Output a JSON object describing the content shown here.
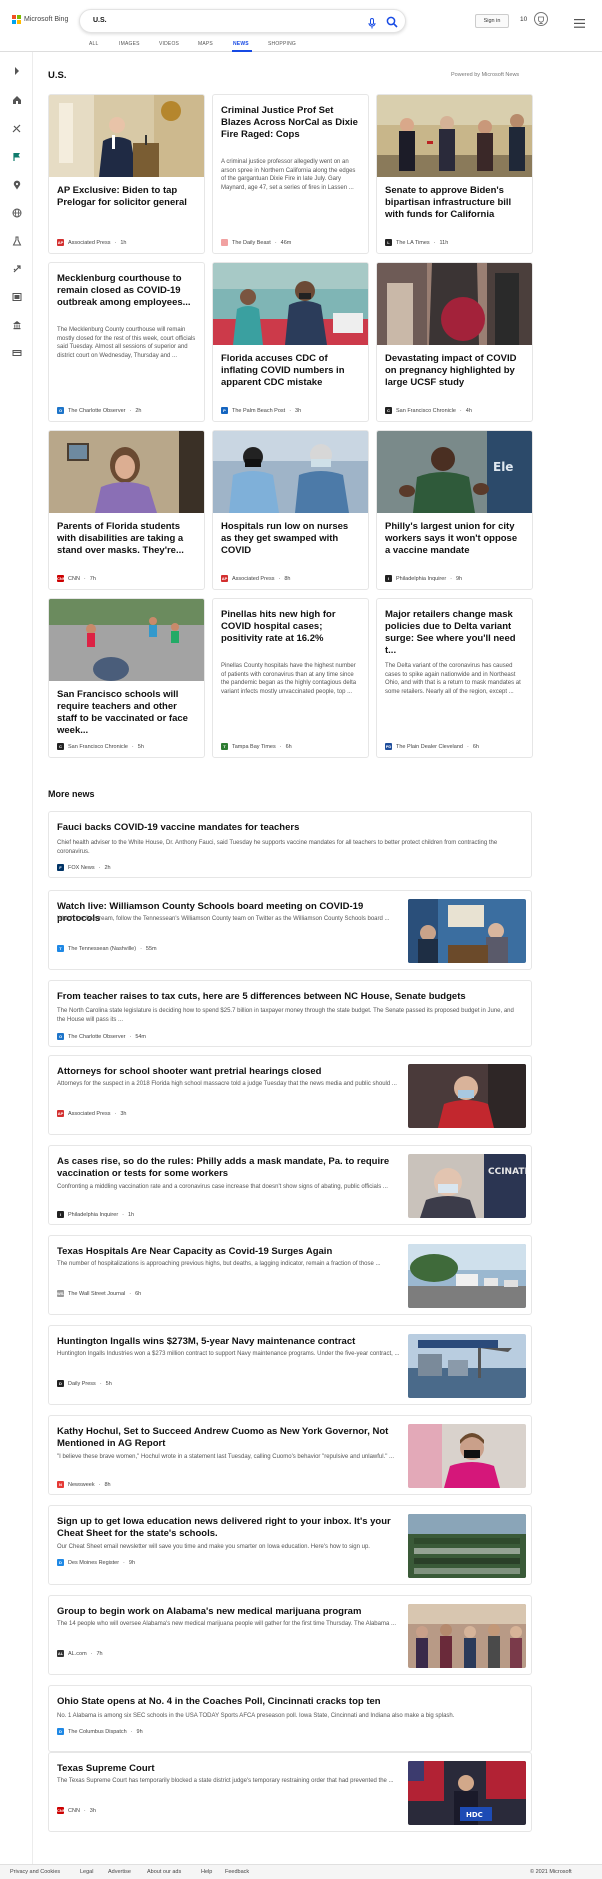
{
  "app": {
    "brand": "Microsoft Bing",
    "query": "U.S.",
    "sign_in": "Sign in",
    "reward_points": "10",
    "brand_colors": [
      "#f25022",
      "#7fba00",
      "#00a4ef",
      "#ffb900"
    ]
  },
  "nav_tabs": [
    {
      "label": "ALL"
    },
    {
      "label": "IMAGES"
    },
    {
      "label": "VIDEOS"
    },
    {
      "label": "MAPS"
    },
    {
      "label": "NEWS",
      "active": true
    },
    {
      "label": "SHOPPING"
    }
  ],
  "sidebar": {
    "icons": [
      "collapse-arrow-icon",
      "home-icon",
      "sports-icon",
      "flag-icon",
      "location-icon",
      "world-icon",
      "science-icon",
      "technology-icon",
      "entertainment-icon",
      "business-icon",
      "money-icon"
    ]
  },
  "main": {
    "title": "U.S.",
    "powered_by": "Powered by Microsoft News"
  },
  "cards": [
    {
      "title": "AP Exclusive: Biden to tap Prelogar for solicitor general",
      "snippet": "",
      "source": "Associated Press",
      "age": "1h",
      "fav": "AP",
      "fav_color": "#d32f2f"
    },
    {
      "title": "Criminal Justice Prof Set Blazes Across NorCal as Dixie Fire Raged: Cops",
      "snippet": "A criminal justice professor allegedly went on an arson spree in Northern California along the edges of the gargantuan Dixie Fire in late July. Gary Maynard, age 47, set a series of fires in Lassen ...",
      "source": "The Daily Beast",
      "age": "46m",
      "fav": "",
      "fav_color": "#f1a1a1"
    },
    {
      "title": "Senate to approve Biden's bipartisan infrastructure bill with funds for California",
      "snippet": "",
      "source": "The LA Times",
      "age": "11h",
      "fav": "L",
      "fav_color": "#222222"
    },
    {
      "title": "Mecklenburg courthouse to remain closed as COVID-19 outbreak among employees...",
      "snippet": "The Mecklenburg County courthouse will remain mostly closed for the rest of this week, court officials said Tuesday. Almost all sessions of superior and district court on Wednesday, Thursday and ...",
      "source": "The Charlotte Observer",
      "age": "2h",
      "fav": "O",
      "fav_color": "#1d74c9"
    },
    {
      "title": "Florida accuses CDC of inflating COVID numbers in apparent CDC mistake",
      "snippet": "",
      "source": "The Palm Beach Post",
      "age": "3h",
      "fav": "P",
      "fav_color": "#1565c0"
    },
    {
      "title": "Devastating impact of COVID on pregnancy highlighted by large UCSF study",
      "snippet": "",
      "source": "San Francisco Chronicle",
      "age": "4h",
      "fav": "C",
      "fav_color": "#222222"
    },
    {
      "title": "Parents of Florida students with disabilities are taking a stand over masks. They're...",
      "snippet": "",
      "source": "CNN",
      "age": "7h",
      "fav": "CNN",
      "fav_color": "#cc0000"
    },
    {
      "title": "Hospitals run low on nurses as they get swamped with COVID",
      "snippet": "",
      "source": "Associated Press",
      "age": "8h",
      "fav": "AP",
      "fav_color": "#d32f2f"
    },
    {
      "title": "Philly's largest union for city workers says it won't oppose a vaccine mandate",
      "snippet": "",
      "source": "Philadelphia Inquirer",
      "age": "9h",
      "fav": "I",
      "fav_color": "#222222"
    },
    {
      "title": "San Francisco schools will require teachers and other staff to be vaccinated or face week...",
      "snippet": "",
      "source": "San Francisco Chronicle",
      "age": "5h",
      "fav": "C",
      "fav_color": "#222222"
    },
    {
      "title": "Pinellas hits new high for COVID hospital cases; positivity rate at 16.2%",
      "snippet": "Pinellas County hospitals have the highest number of patients with coronavirus than at any time since the pandemic began as the highly contagious delta variant infects mostly unvaccinated people, top ...",
      "source": "Tampa Bay Times",
      "age": "6h",
      "fav": "T",
      "fav_color": "#2e7d32"
    },
    {
      "title": "Major retailers change mask policies due to Delta variant surge: See where you'll need t...",
      "snippet": "The Delta variant of the coronavirus has caused cases to spike again nationwide and in Northeast Ohio, and with that is a return to mask mandates at some retailers. Nearly all of the region, except ...",
      "source": "The Plain Dealer Cleveland",
      "age": "6h",
      "fav": "PD",
      "fav_color": "#1e4d9b"
    }
  ],
  "more_news": {
    "title": "More news",
    "items": [
      {
        "title": "Fauci backs COVID-19 vaccine mandates for teachers",
        "snippet": "Chief health adviser to the White House, Dr. Anthony Fauci, said Tuesday he supports vaccine mandates for all teachers to better protect children from contracting the coronavirus.",
        "source": "FOX News",
        "age": "2h",
        "fav": "F",
        "fav_color": "#003366"
      },
      {
        "title": "Watch live: Williamson County Schools board meeting on COVID-19 protocols",
        "snippet": "Watch the livestream, follow the Tennessean's Williamson County team on Twitter as the Williamson County Schools board ...",
        "source": "The Tennessean (Nashville)",
        "age": "55m",
        "fav": "T",
        "fav_color": "#1e88e5"
      },
      {
        "title": "From teacher raises to tax cuts, here are 5 differences between NC House, Senate budgets",
        "snippet": "The North Carolina state legislature is deciding how to spend $25.7 billion in taxpayer money through the state budget. The Senate passed its proposed budget in June, and the House will pass its ...",
        "source": "The Charlotte Observer",
        "age": "54m",
        "fav": "O",
        "fav_color": "#1d74c9"
      },
      {
        "title": "Attorneys for school shooter want pretrial hearings closed",
        "snippet": "Attorneys for the suspect in a 2018 Florida high school massacre told a judge Tuesday that the news media and public should ...",
        "source": "Associated Press",
        "age": "3h",
        "fav": "AP",
        "fav_color": "#d32f2f"
      },
      {
        "title": "As cases rise, so do the rules: Philly adds a mask mandate, Pa. to require vaccination or tests for some workers",
        "snippet": "Confronting a middling vaccination rate and a coronavirus case increase that doesn't show signs of abating, public officials ...",
        "source": "Philadelphia Inquirer",
        "age": "1h",
        "fav": "I",
        "fav_color": "#222222"
      },
      {
        "title": "Texas Hospitals Are Near Capacity as Covid-19 Surges Again",
        "snippet": "The number of hospitalizations is approaching previous highs, but deaths, a lagging indicator, remain a fraction of those ...",
        "source": "The Wall Street Journal",
        "age": "6h",
        "fav": "WSJ",
        "fav_color": "#999999"
      },
      {
        "title": "Huntington Ingalls wins $273M, 5-year Navy maintenance contract",
        "snippet": "Huntington Ingalls Industries won a $273 million contract to support Navy maintenance programs. Under the five-year contract, ...",
        "source": "Daily Press",
        "age": "5h",
        "fav": "D",
        "fav_color": "#222222"
      },
      {
        "title": "Kathy Hochul, Set to Succeed Andrew Cuomo as New York Governor, Not Mentioned in AG Report",
        "snippet": "\"I believe these brave women,\" Hochul wrote in a statement last Tuesday, calling Cuomo's behavior \"repulsive and unlawful.\" ...",
        "source": "Newsweek",
        "age": "8h",
        "fav": "N",
        "fav_color": "#e53935"
      },
      {
        "title": "Sign up to get Iowa education news delivered right to your inbox. It's your Cheat Sheet for the state's schools.",
        "snippet": "Our Cheat Sheet email newsletter will save you time and make you smarter on Iowa education. Here's how to sign up.",
        "source": "Des Moines Register",
        "age": "9h",
        "fav": "D",
        "fav_color": "#1e88e5"
      },
      {
        "title": "Group to begin work on Alabama's new medical marijuana program",
        "snippet": "The 14 people who will oversee Alabama's new medical marijuana people will gather for the first time Thursday. The Alabama ...",
        "source": "AL.com",
        "age": "7h",
        "fav": "AL",
        "fav_color": "#333333"
      },
      {
        "title": "Ohio State opens at No. 4 in the Coaches Poll, Cincinnati cracks top ten",
        "snippet": "No. 1 Alabama is among six SEC schools in the USA TODAY Sports AFCA preseason poll. Iowa State, Cincinnati and Indiana also make a big splash.",
        "source": "The Columbus Dispatch",
        "age": "9h",
        "fav": "D",
        "fav_color": "#1e88e5"
      },
      {
        "title": "Texas Supreme Court",
        "snippet": "The Texas Supreme Court has temporarily blocked a state district judge's temporary restraining order that had prevented the ...",
        "source": "CNN",
        "age": "3h",
        "fav": "CNN",
        "fav_color": "#cc0000"
      }
    ]
  },
  "footer": {
    "links": [
      "Privacy and Cookies",
      "Legal",
      "Advertise",
      "About our ads",
      "Help",
      "Feedback"
    ],
    "copyright": "© 2021 Microsoft"
  }
}
